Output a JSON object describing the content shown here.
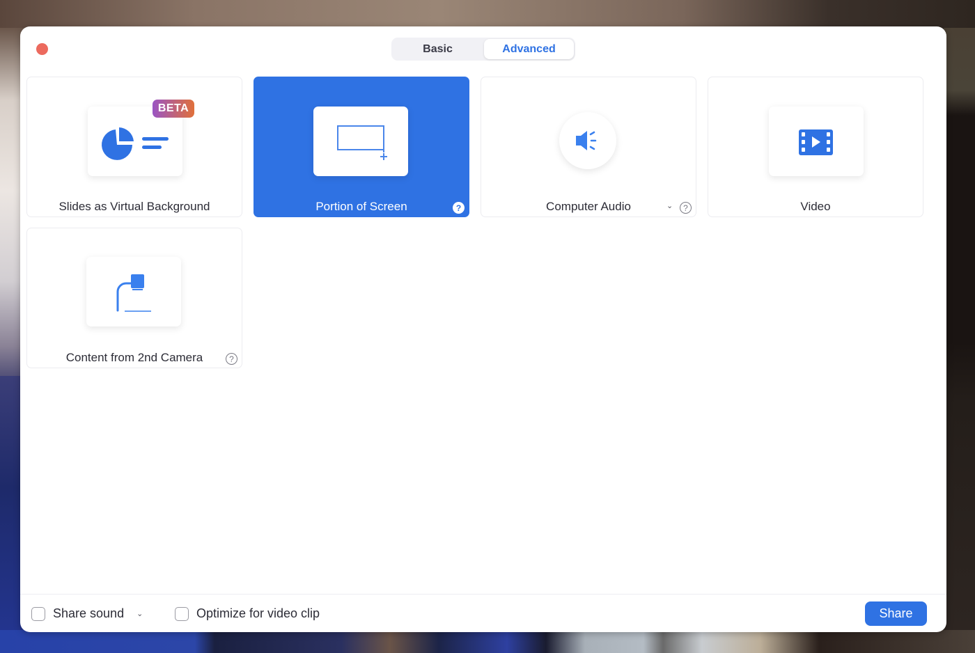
{
  "window": {
    "close_button": "close",
    "tabs": [
      {
        "label": "Basic",
        "selected": false
      },
      {
        "label": "Advanced",
        "selected": true
      }
    ]
  },
  "options": [
    {
      "label": "Slides as Virtual Background",
      "icon": "slides-icon",
      "badge": "BETA",
      "selected": false,
      "help": false,
      "dropdown": false
    },
    {
      "label": "Portion of Screen",
      "icon": "screen-portion-icon",
      "selected": true,
      "help": true,
      "dropdown": false
    },
    {
      "label": "Computer Audio",
      "icon": "speaker-icon",
      "selected": false,
      "help": true,
      "dropdown": true
    },
    {
      "label": "Video",
      "icon": "video-film-icon",
      "selected": false,
      "help": false,
      "dropdown": false
    },
    {
      "label": "Content from 2nd Camera",
      "icon": "document-camera-icon",
      "selected": false,
      "help": true,
      "dropdown": false
    }
  ],
  "help_glyph": "?",
  "chevron_glyph": "⌄",
  "footer": {
    "share_sound": {
      "label": "Share sound",
      "checked": false
    },
    "optimize_video": {
      "label": "Optimize for video clip",
      "checked": false
    },
    "share_button": "Share"
  },
  "colors": {
    "accent": "#2f72e3",
    "close": "#ec6a5e",
    "beta_gradient_start": "#9a55c4",
    "beta_gradient_end": "#e0703a"
  }
}
